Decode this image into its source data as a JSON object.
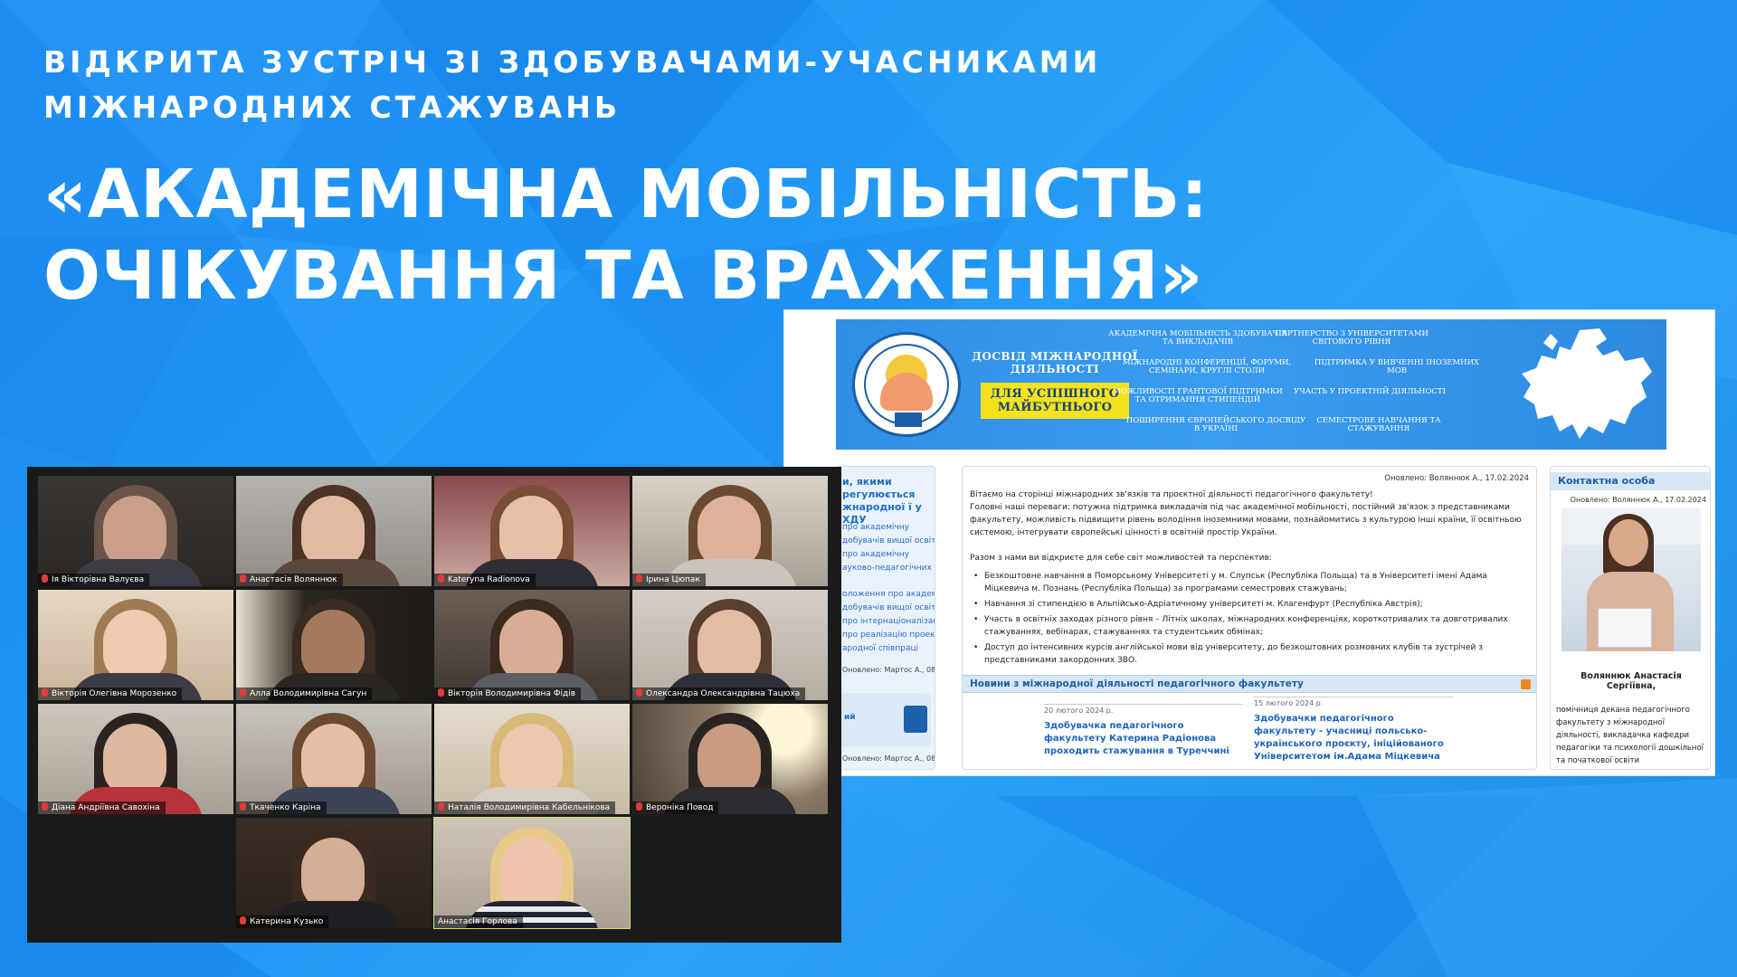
{
  "heading": {
    "subtitle_line1": "ВІДКРИТА ЗУСТРІЧ ЗІ ЗДОБУВАЧАМИ-УЧАСНИКАМИ",
    "subtitle_line2": "МІЖНАРОДНИХ СТАЖУВАНЬ",
    "title_line1": " «АКАДЕМІЧНА МОБІЛЬНІСТЬ:",
    "title_line2": "ОЧІКУВАННЯ ТА ВРАЖЕННЯ»"
  },
  "colors": {
    "background": "#1d8bf0",
    "text": "#ffffff",
    "site_accent": "#2f8fe6",
    "site_link": "#1f64bf",
    "badge_yellow": "#f4e21c",
    "active_speaker": "#c6e86a",
    "mic_muted": "#e23b3b"
  },
  "website": {
    "banner": {
      "logo_label": "ПЕДАГОГІЧНИЙ ФАКУЛЬТЕТ",
      "title": "ДОСВІД МІЖНАРОДНОЇ ДІЯЛЬНОСТІ",
      "badge": "ДЛЯ УСПІШНОГО МАЙБУТНЬОГО",
      "links": [
        "АКАДЕМІЧНА МОБІЛЬНІСТЬ ЗДОБУВАЧІВ ТА ВИКЛАДАЧІВ",
        "ПАРТНЕРСТВО З УНІВЕРСИТЕТАМИ СВІТОВОГО РІВНЯ",
        "МІЖНАРОДНІ КОНФЕРЕНЦІЇ, ФОРУМИ, СЕМІНАРИ, КРУГЛІ СТОЛИ",
        "ПІДТРИМКА У ВИВЧЕННІ ІНОЗЕМНИХ МОВ",
        "МОЖЛИВОСТІ ГРАНТОВОЇ ПІДТРИМКИ ТА ОТРИМАННЯ СТИПЕНДІЙ",
        "УЧАСТЬ У ПРОЕКТНІЙ ДІЯЛЬНОСТІ",
        "ПОШИРЕННЯ ЄВРОПЕЙСЬКОГО ДОСВІДУ В УКРАЇНІ",
        "СЕМЕСТРОВЕ НАВЧАННЯ ТА СТАЖУВАННЯ"
      ]
    },
    "left": {
      "title": "и, якими регулюється жнародної ї у ХДУ",
      "links": [
        "про академічну",
        "добувачів вищої освіти",
        "про академічну",
        "ауково-педагогічних",
        "оложення про академічну",
        "добувачів вищої освіти",
        "про інтернаціоналізацію",
        "про реалізацію проектів",
        "ародної співпраці"
      ],
      "date1": "Оновлено: Мартос А., 08.11.2023",
      "block_label": "ий",
      "date2": "Оновлено: Мартос А., 08.11.2023"
    },
    "main": {
      "updated": "Оновлено: Воляннюк А., 17.02.2024",
      "greeting": "Вітаємо на сторінці міжнародних зв'язків та проєктної діяльності педагогічного факультету!",
      "intro": "Головні наші переваги: потужна підтримка викладачів під час академічної мобільності, постійний зв'язок з представниками факультету, можливість підвищити рівень володіння іноземними мовами, познайомитись з культурою інші країни, її освітньою системою, інтегрувати європейські цінності в освітній простір України.",
      "together": "Разом з нами ви відкриєте для себе світ можливостей та перспектив:",
      "bullets": [
        "Безкоштовне навчання в Поморському Університеті у м. Слупськ (Республіка Польща) та в Університеті імені Адама Міцкевича м. Познань (Республіка Польща) за програмами семестрових стажувань;",
        "Навчання зі стипендією в Альпійсько-Адріатичному університеті м. Клагенфурт (Республіка Австрія);",
        "Участь в освітніх заходах різного рівня – Літніх школах, міжнародних конференціях, короткотривалих та довготривалих стажуваннях, вебінарах, стажуваннях та студентських обмінах;",
        "Доступ до інтенсивних курсів англійської мови від університету, до безкоштовних розмовних клубів та зустрічей з представниками закордонних ЗВО."
      ],
      "news_header": "Новини з міжнародної діяльності педагогічного факультету",
      "news": [
        {
          "date": "20 лютого 2024 р.",
          "title": "Здобувачка педагогічного факультету Катерина Радіонова проходить стажування в Туреччині"
        },
        {
          "date": "15 лютого 2024 р.",
          "title": "Здобувачки педагогічного факультету - учасниці польсько-українського проєкту, ініційованого Університетом ім.Адама Міцкевича"
        }
      ]
    },
    "contact": {
      "header": "Контактна особа",
      "updated": "Оновлено: Воляннюк А., 17.02.2024",
      "name": "Воляннюк Анастасія Сергіївна,",
      "description": "помічниця декана педагогічного факультету з міжнародної діяльності, викладачка кафедри педагогіки та психології дошкільної та початкової освіти"
    }
  },
  "zoom": {
    "participants": [
      {
        "name": "Ія Вікторівна Валуєва",
        "muted": true,
        "active": false
      },
      {
        "name": "Анастасія Воляннюк",
        "muted": true,
        "active": false
      },
      {
        "name": "Kateryna Radionova",
        "muted": true,
        "active": false
      },
      {
        "name": "Ірина Цюпак",
        "muted": true,
        "active": false
      },
      {
        "name": "Вікторія Олегівна Морозенко",
        "muted": true,
        "active": false
      },
      {
        "name": "Алла Володимирівна Сагун",
        "muted": true,
        "active": false
      },
      {
        "name": "Вікторія Володимирівна Фідів",
        "muted": true,
        "active": false
      },
      {
        "name": "Олександра Олександрівна Тацюха",
        "muted": true,
        "active": false
      },
      {
        "name": "Діана Андріївна Савохіна",
        "muted": true,
        "active": false
      },
      {
        "name": "Ткаченко Каріна",
        "muted": true,
        "active": false
      },
      {
        "name": "Наталія Володимирівна Кабельнікова",
        "muted": true,
        "active": false
      },
      {
        "name": "Вероніка Повод",
        "muted": true,
        "active": false
      },
      {
        "name": "Катерина Кузько",
        "muted": true,
        "active": false
      },
      {
        "name": "Анастасія Горлова",
        "muted": false,
        "active": true
      }
    ]
  }
}
